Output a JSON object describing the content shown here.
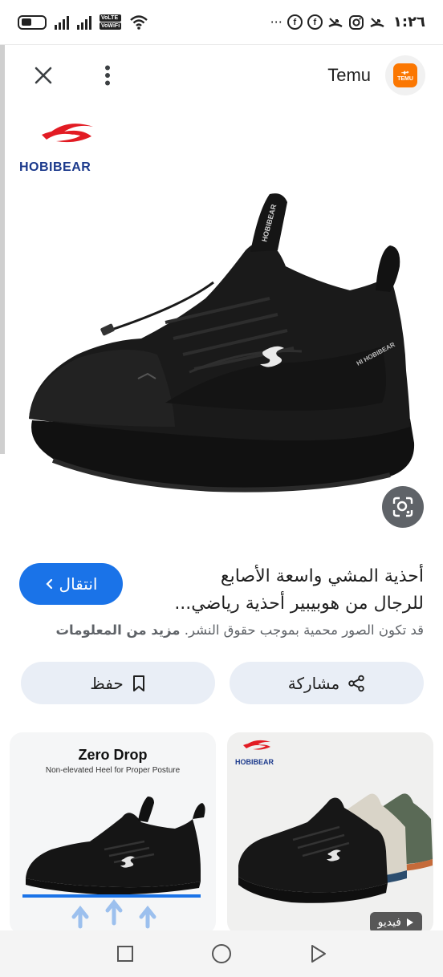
{
  "status_bar": {
    "time": "١:٢٦",
    "volte_top": "VoLTE",
    "volte_bottom": "VoWiFi",
    "sim1": "1",
    "sim2": "2",
    "overflow": "···"
  },
  "top_bar": {
    "source_name": "Temu",
    "source_logo_line1": "مهـ",
    "source_logo_line2": "TEMU"
  },
  "hero": {
    "brand_logo_text": "HOBIBEAR",
    "shoe_side_text": "HI HOBIBEAR"
  },
  "info": {
    "title_line1": "أحذية المشي واسعة الأصابع",
    "title_line2": "للرجال من هوبيبير أحذية رياضي...",
    "visit_label": "انتقال",
    "copyright_text": "قد تكون الصور محمية بموجب حقوق النشر.",
    "more_info_label": "مزيد من المعلومات"
  },
  "actions": {
    "share_label": "مشاركة",
    "save_label": "حفظ"
  },
  "related": {
    "left_card": {
      "title": "Zero Drop",
      "subtitle": "Non-elevated Heel for Proper Posture"
    },
    "right_card": {
      "brand": "HOBIBEAR",
      "video_label": "فيديو"
    }
  },
  "colors": {
    "primary": "#1a73e8",
    "tonal_button": "#e9eef6",
    "temu_orange": "#fb7701",
    "brand_red": "#e21b23",
    "brand_navy": "#1c3a8c"
  }
}
